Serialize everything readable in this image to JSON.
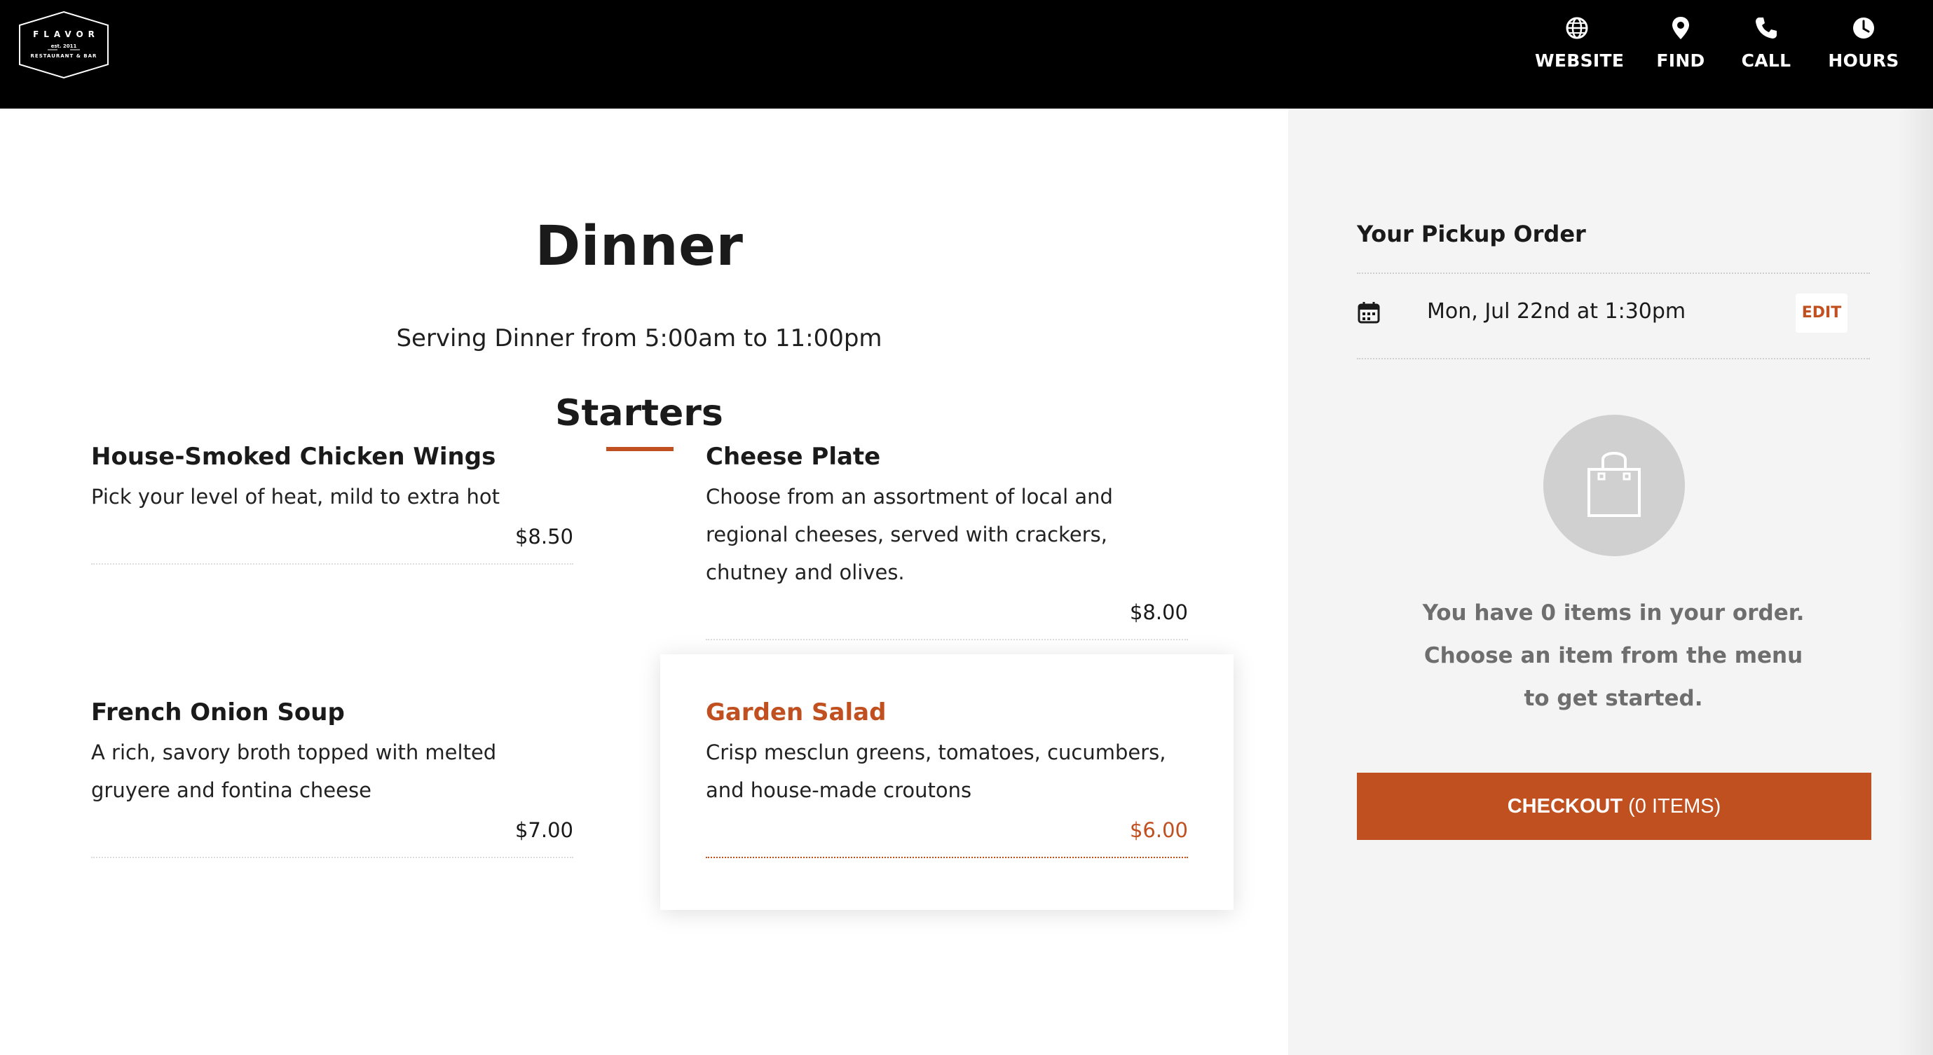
{
  "brand": {
    "name": "FLAVOR",
    "est": "est. 2011",
    "tagline": "RESTAURANT & BAR"
  },
  "nav": [
    {
      "label": "WEBSITE",
      "icon": "globe-icon"
    },
    {
      "label": "FIND",
      "icon": "map-pin-icon"
    },
    {
      "label": "CALL",
      "icon": "phone-icon"
    },
    {
      "label": "HOURS",
      "icon": "clock-icon"
    }
  ],
  "menu": {
    "title": "Dinner",
    "subtitle": "Serving Dinner from 5:00am to 11:00pm",
    "section": "Starters",
    "items": [
      {
        "name": "House-Smoked Chicken Wings",
        "description": "Pick your level of heat, mild to extra hot",
        "price": "$8.50"
      },
      {
        "name": "Cheese Plate",
        "description": "Choose from an assortment of local and regional cheeses, served with crackers, chutney and olives.",
        "price": "$8.00"
      },
      {
        "name": "French Onion Soup",
        "description": "A rich, savory broth topped with melted gruyere and fontina cheese",
        "price": "$7.00"
      },
      {
        "name": "Garden Salad",
        "description": "Crisp mesclun greens, tomatoes, cucumbers, and house-made croutons",
        "price": "$6.00"
      }
    ]
  },
  "order": {
    "title": "Your Pickup Order",
    "pickup_time": "Mon, Jul 22nd at 1:30pm",
    "edit_label": "EDIT",
    "empty_lines": [
      "You have 0 items in your order.",
      "Choose an item from the menu",
      "to get started."
    ],
    "checkout_strong": "CHECKOUT",
    "checkout_rest": " (0 ITEMS)"
  },
  "colors": {
    "accent": "#c0501f",
    "header_bg": "#000000",
    "sidebar_bg": "#f4f4f4"
  }
}
